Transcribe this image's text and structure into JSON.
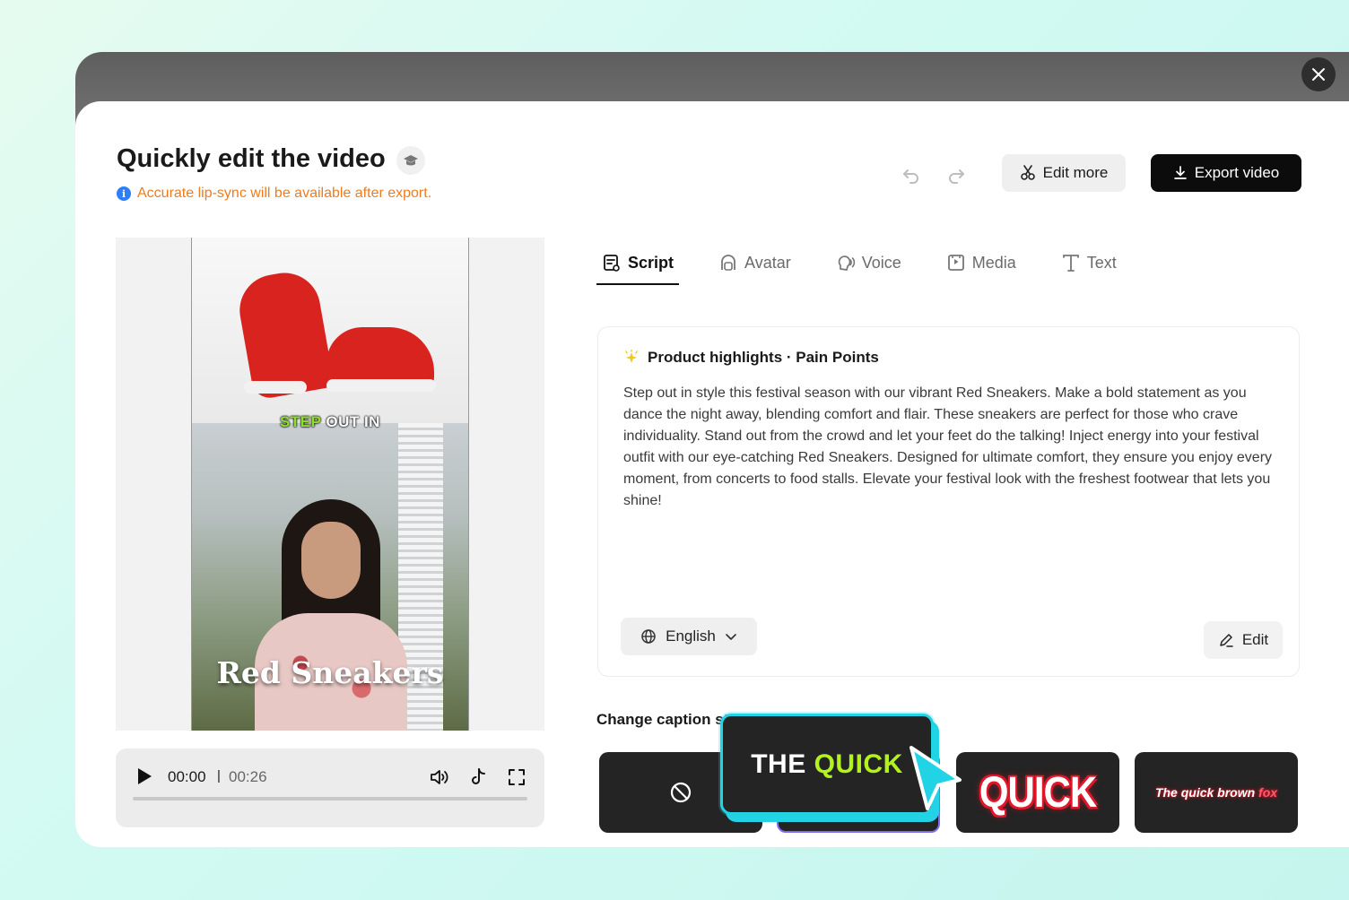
{
  "header": {
    "title": "Quickly edit the video",
    "notice": "Accurate lip-sync will be available after export.",
    "edit_more_label": "Edit more",
    "export_label": "Export video"
  },
  "preview": {
    "caption_top_highlight": "STEP",
    "caption_top_rest": " OUT IN",
    "caption_bottom": "Red Sneakers"
  },
  "player": {
    "current_time": "00:00",
    "separator": "|",
    "total_time": "00:26",
    "progress": 0
  },
  "tabs": [
    {
      "label": "Script",
      "icon": "script-icon",
      "active": true
    },
    {
      "label": "Avatar",
      "icon": "avatar-icon",
      "active": false
    },
    {
      "label": "Voice",
      "icon": "voice-icon",
      "active": false
    },
    {
      "label": "Media",
      "icon": "media-icon",
      "active": false
    },
    {
      "label": "Text",
      "icon": "text-icon",
      "active": false
    }
  ],
  "script": {
    "heading": "Product highlights · Pain Points",
    "body": "Step out in style this festival season with our vibrant Red Sneakers. Make a bold statement as you dance the night away, blending comfort and flair. These sneakers are perfect for those who crave individuality. Stand out from the crowd and let your feet do the talking! Inject energy into your festival outfit with our eye-catching Red Sneakers. Designed for ultimate comfort, they ensure you enjoy every moment, from concerts to food stalls. Elevate your festival look with the freshest footwear that lets you shine!",
    "language": "English",
    "edit_label": "Edit"
  },
  "captions": {
    "label": "Change caption st",
    "popup_white": "THE ",
    "popup_highlight": "QUICK",
    "tile_quick": "QUICK",
    "tile_fox_main": "The quick brown ",
    "tile_fox_accent": "fox"
  },
  "colors": {
    "notice_orange": "#f07b1c",
    "info_blue": "#2d7ff9",
    "caption_green": "#8ee02a",
    "popup_cyan": "#22d3e6",
    "quick_red": "#e0172a",
    "selected_purple": "#7b6cf0"
  }
}
